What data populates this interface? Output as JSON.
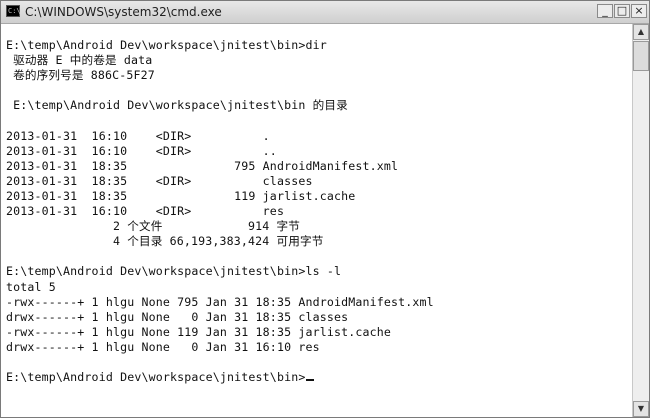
{
  "window": {
    "title": "C:\\WINDOWS\\system32\\cmd.exe",
    "icon": "console-icon",
    "icon_glyph": "C:\\",
    "controls": {
      "minimize": "_",
      "maximize": "□",
      "close": "×"
    }
  },
  "console": {
    "lines": [
      "E:\\temp\\Android Dev\\workspace\\jnitest\\bin>dir",
      " 驱动器 E 中的卷是 data",
      " 卷的序列号是 886C-5F27",
      "",
      " E:\\temp\\Android Dev\\workspace\\jnitest\\bin 的目录",
      "",
      "2013-01-31  16:10    <DIR>          .",
      "2013-01-31  16:10    <DIR>          ..",
      "2013-01-31  18:35               795 AndroidManifest.xml",
      "2013-01-31  18:35    <DIR>          classes",
      "2013-01-31  18:35               119 jarlist.cache",
      "2013-01-31  16:10    <DIR>          res",
      "               2 个文件            914 字节",
      "               4 个目录 66,193,383,424 可用字节",
      "",
      "E:\\temp\\Android Dev\\workspace\\jnitest\\bin>ls -l",
      "total 5",
      "-rwx------+ 1 hlgu None 795 Jan 31 18:35 AndroidManifest.xml",
      "drwx------+ 1 hlgu None   0 Jan 31 18:35 classes",
      "-rwx------+ 1 hlgu None 119 Jan 31 18:35 jarlist.cache",
      "drwx------+ 1 hlgu None   0 Jan 31 16:10 res",
      "",
      "E:\\temp\\Android Dev\\workspace\\jnitest\\bin>"
    ]
  },
  "scrollbar": {
    "up_icon": "▲",
    "down_icon": "▼"
  }
}
